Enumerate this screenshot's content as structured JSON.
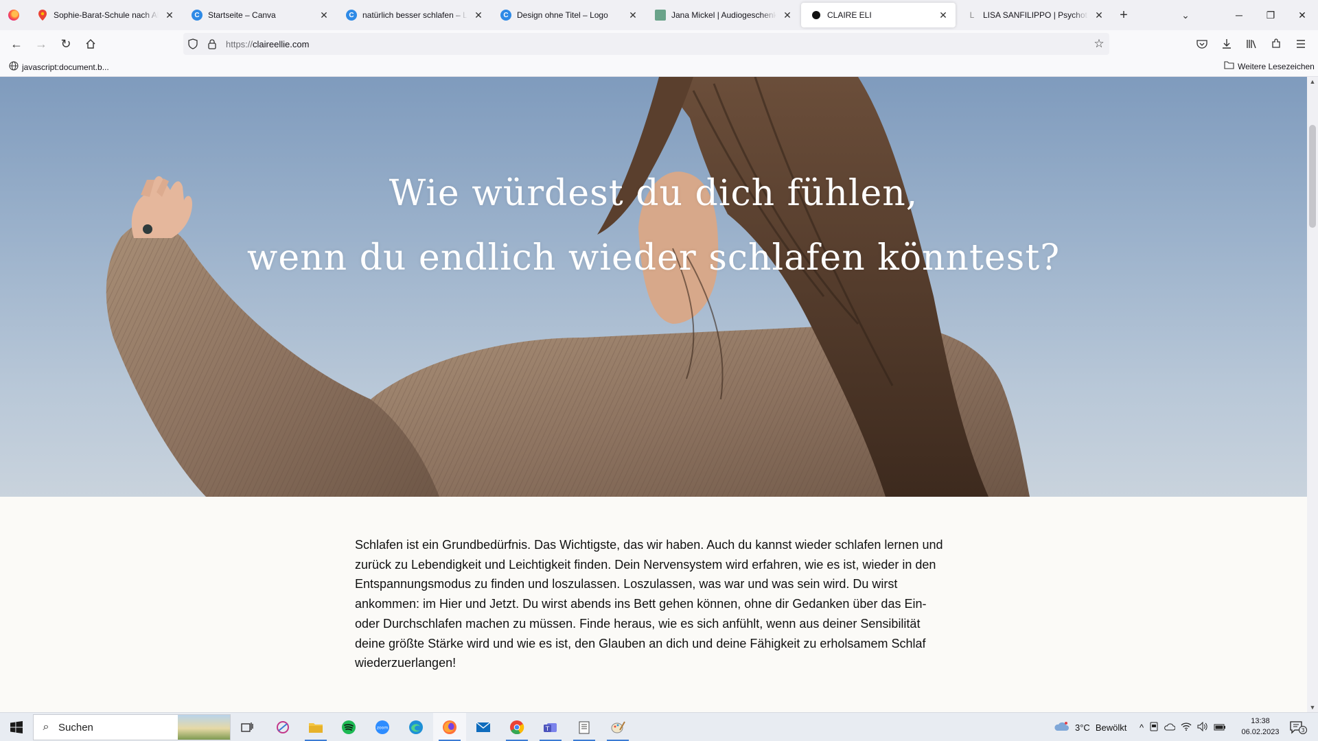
{
  "browser": {
    "tabs": [
      {
        "title": "Sophie-Barat-Schule nach Alte Poststraße",
        "fav_color": "#34a853",
        "fav_glyph": "●"
      },
      {
        "title": "Startseite – Canva",
        "fav_color": "#2e8ae6",
        "fav_glyph": "C"
      },
      {
        "title": "natürlich besser schlafen – Logo",
        "fav_color": "#2e8ae6",
        "fav_glyph": "C"
      },
      {
        "title": "Design ohne Titel – Logo",
        "fav_color": "#2e8ae6",
        "fav_glyph": "C"
      },
      {
        "title": "Jana Mickel | Audiogeschenk: Gr",
        "fav_color": "#6aa38a",
        "fav_glyph": "■"
      },
      {
        "title": "CLAIRE ELI",
        "fav_color": "#111111",
        "fav_glyph": "●"
      },
      {
        "title": "LISA SANFILIPPO | Psychotherapie",
        "fav_color": "#dddddd",
        "fav_glyph": "L"
      }
    ],
    "active_tab_index": 5,
    "url_prefix": "https://",
    "url_host": "claireellie.com",
    "bookmark_left": "javascript:document.b...",
    "bookmark_right": "Weitere Lesezeichen"
  },
  "page": {
    "hero_line1": "Wie würdest du dich fühlen,",
    "hero_line2": "wenn du endlich wieder schlafen könntest?",
    "body": "Schlafen ist ein Grundbedürfnis. Das Wichtigste, das wir haben. Auch du kannst wieder schlafen lernen und zurück zu Lebendigkeit und Leichtigkeit finden. Dein Nervensystem wird erfahren, wie es ist, wieder in den Entspannungsmodus zu finden und loszulassen. Loszulassen, was war und was sein wird. Du wirst ankommen: im Hier und Jetzt. Du wirst abends ins Bett gehen können, ohne dir Gedanken über das Ein- oder Durchschlafen machen zu müssen. Finde heraus, wie es sich anfühlt, wenn aus deiner Sensibilität deine größte Stärke wird und wie es ist, den Glauben an dich und deine Fähigkeit zu erholsamem Schlaf wiederzuerlangen!"
  },
  "taskbar": {
    "search_label": "Suchen",
    "weather_temp": "3°C",
    "weather_text": "Bewölkt",
    "time": "13:38",
    "date": "06.02.2023",
    "notification_count": "3"
  },
  "icons": [
    "firefox-logo-icon",
    "back-icon",
    "forward-icon",
    "reload-icon",
    "home-icon",
    "shield-icon",
    "lock-icon",
    "star-icon",
    "pocket-icon",
    "download-icon",
    "library-icon",
    "extensions-icon",
    "menu-icon",
    "globe-icon",
    "folder-icon",
    "windows-start-icon",
    "search-icon",
    "task-view-icon",
    "spotify-icon",
    "zoom-icon",
    "edge-icon",
    "mail-icon",
    "chrome-icon",
    "teams-icon",
    "cloud-icon",
    "wifi-icon",
    "volume-icon",
    "battery-icon",
    "notification-icon"
  ]
}
